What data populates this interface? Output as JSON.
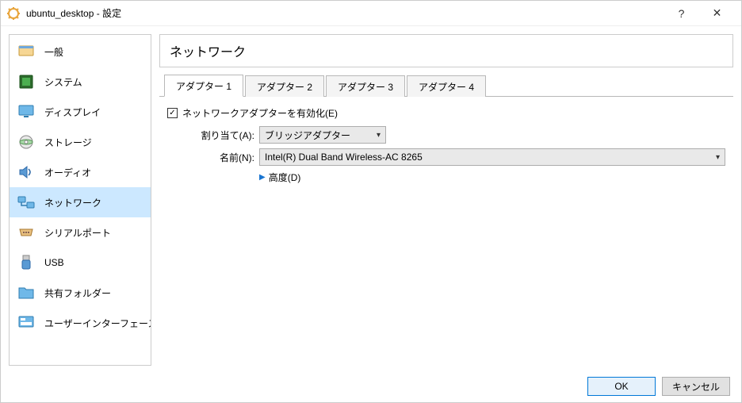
{
  "window": {
    "title": "ubuntu_desktop - 設定"
  },
  "titlebar": {
    "help": "?",
    "close": "✕"
  },
  "sidebar": {
    "items": [
      {
        "id": "general",
        "label": "一般"
      },
      {
        "id": "system",
        "label": "システム"
      },
      {
        "id": "display",
        "label": "ディスプレイ"
      },
      {
        "id": "storage",
        "label": "ストレージ"
      },
      {
        "id": "audio",
        "label": "オーディオ"
      },
      {
        "id": "network",
        "label": "ネットワーク"
      },
      {
        "id": "serial",
        "label": "シリアルポート"
      },
      {
        "id": "usb",
        "label": "USB"
      },
      {
        "id": "shared",
        "label": "共有フォルダー"
      },
      {
        "id": "ui",
        "label": "ユーザーインターフェース"
      }
    ],
    "selected": "network"
  },
  "main": {
    "heading": "ネットワーク",
    "tabs": [
      {
        "label": "アダプター 1",
        "active": true
      },
      {
        "label": "アダプター 2",
        "active": false
      },
      {
        "label": "アダプター 3",
        "active": false
      },
      {
        "label": "アダプター 4",
        "active": false
      }
    ],
    "enable_adapter": {
      "checked": true,
      "label": "ネットワークアダプターを有効化(E)"
    },
    "attached_to": {
      "label": "割り当て(A):",
      "value": "ブリッジアダプター"
    },
    "name": {
      "label": "名前(N):",
      "value": "Intel(R) Dual Band Wireless-AC 8265"
    },
    "advanced": {
      "label": "高度(D)"
    }
  },
  "footer": {
    "ok": "OK",
    "cancel": "キャンセル"
  },
  "colors": {
    "selection": "#cce8ff",
    "accent": "#0078d7"
  }
}
